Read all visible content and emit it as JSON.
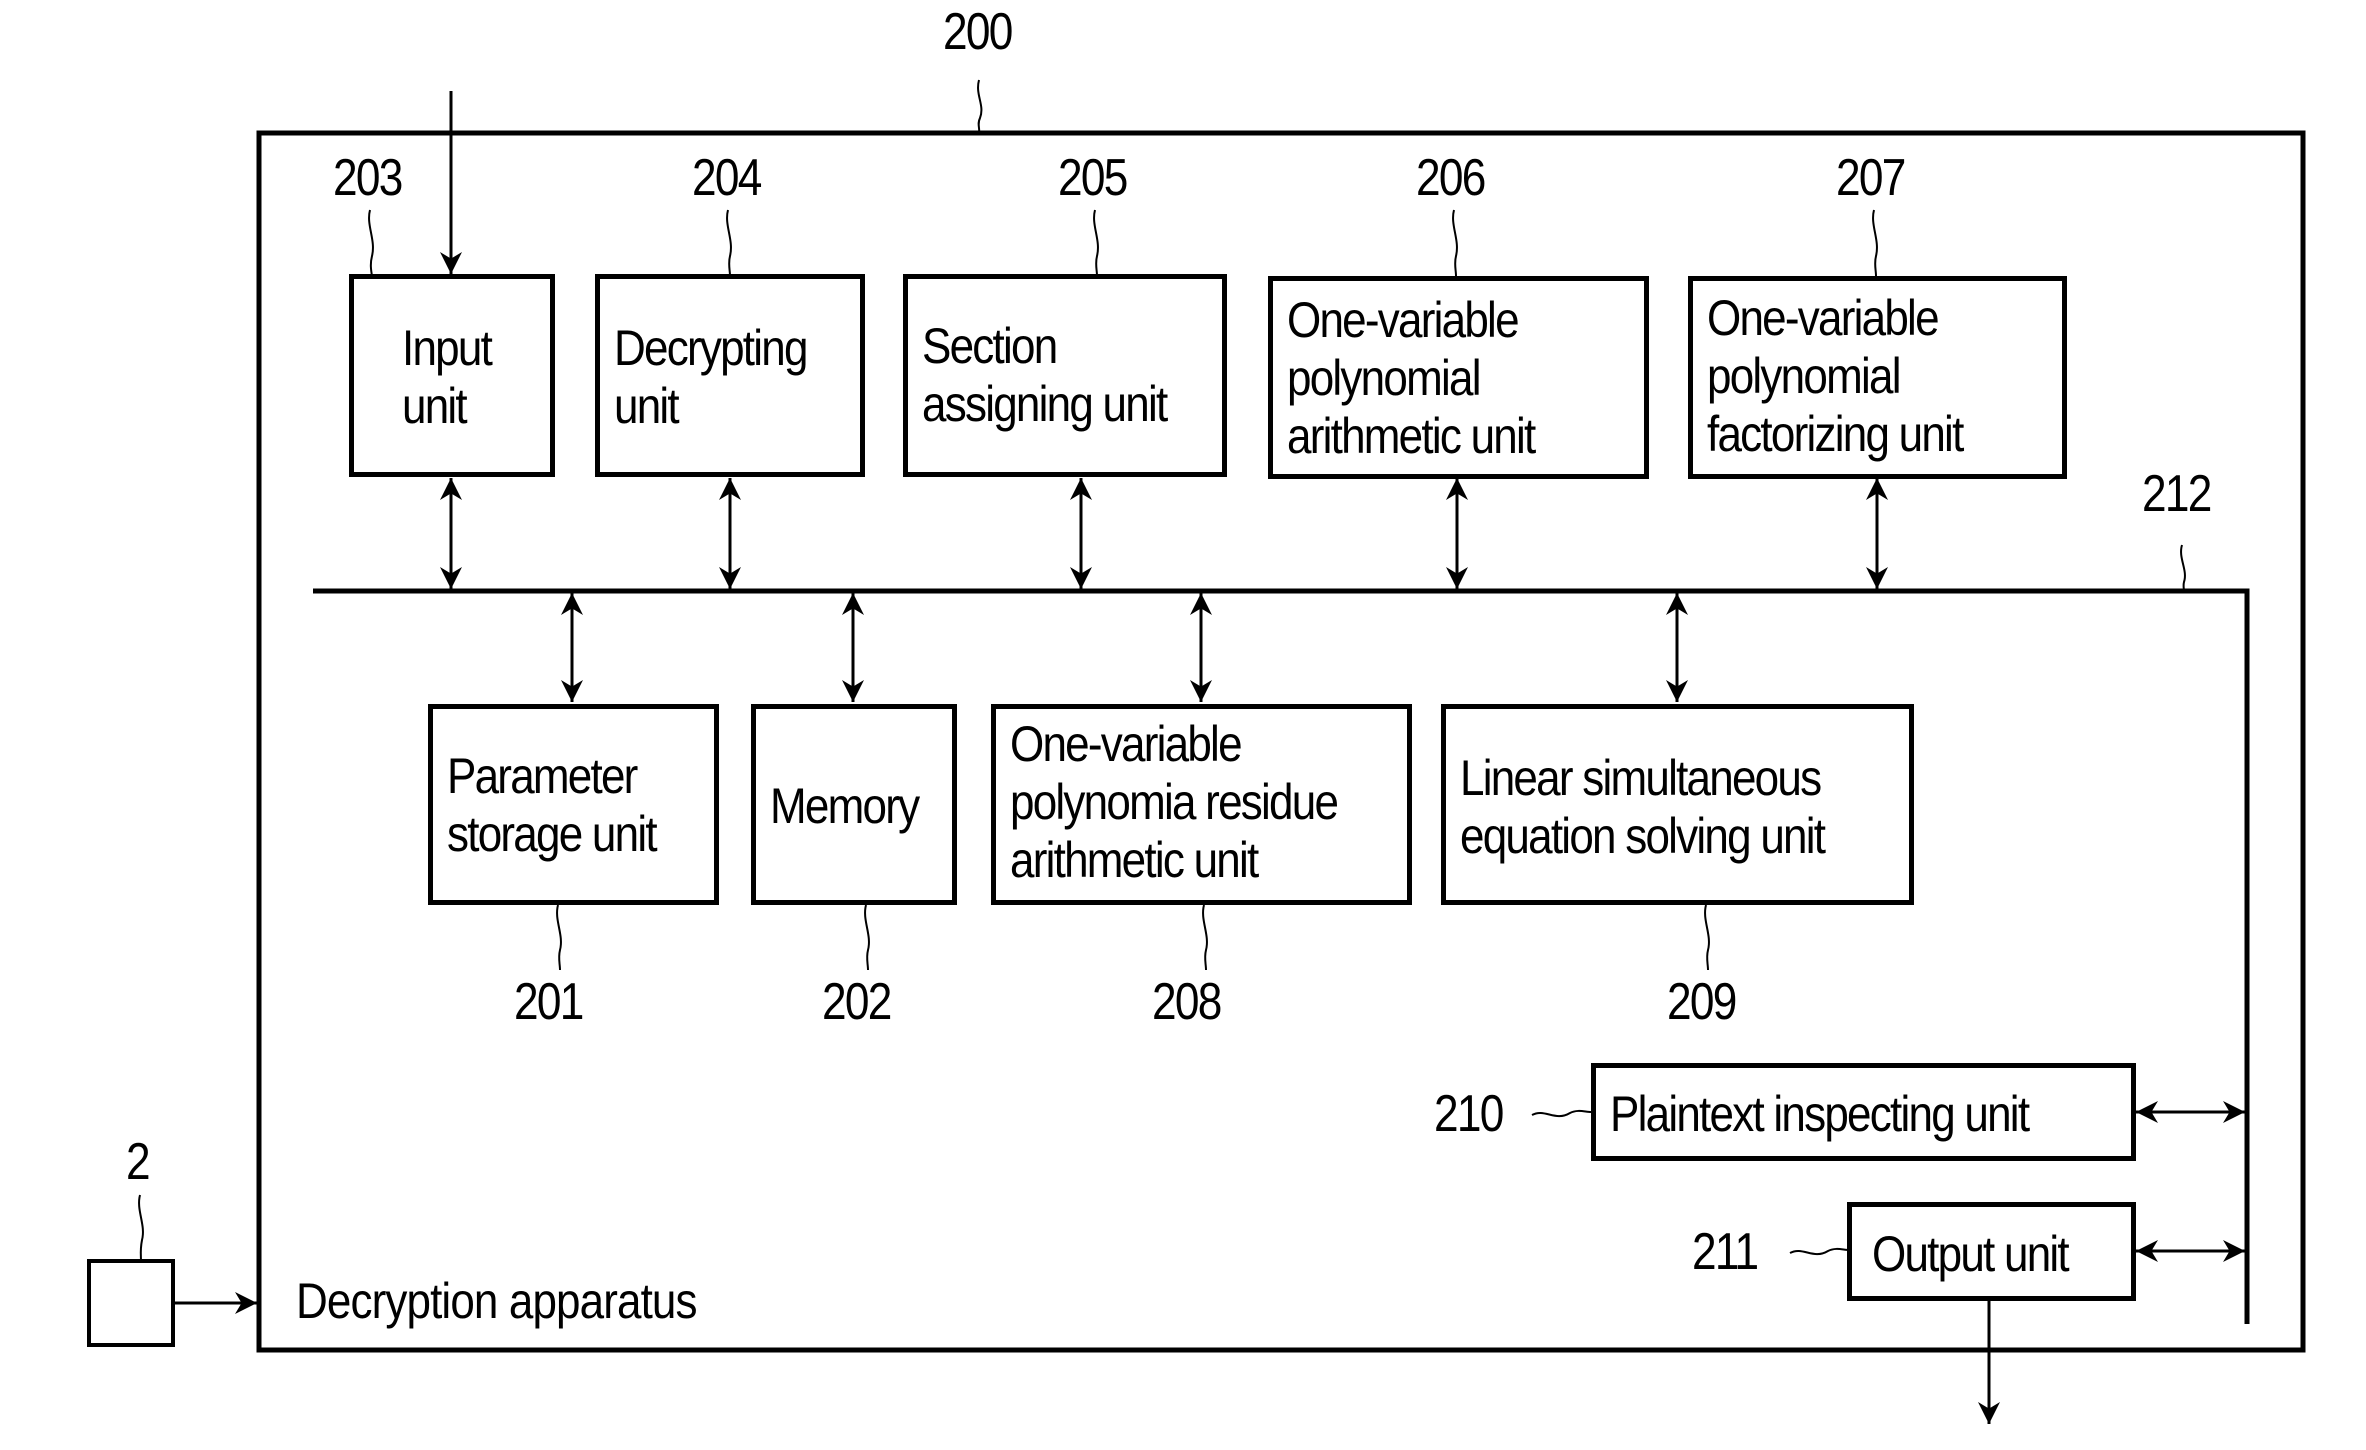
{
  "figure": {
    "apparatus_label": "Decryption apparatus",
    "apparatus_ref": "200",
    "bus_ref": "212",
    "external_ref": "2",
    "colors": {
      "line": "#000000",
      "background": "#ffffff"
    }
  },
  "units": [
    {
      "ref": "203",
      "lines": [
        "Input",
        "unit"
      ]
    },
    {
      "ref": "204",
      "lines": [
        "Decrypting",
        "unit"
      ]
    },
    {
      "ref": "205",
      "lines": [
        "Section",
        "assigning unit"
      ]
    },
    {
      "ref": "206",
      "lines": [
        "One-variable",
        "polynomial",
        "arithmetic unit"
      ]
    },
    {
      "ref": "207",
      "lines": [
        "One-variable",
        "polynomial",
        "factorizing unit"
      ]
    },
    {
      "ref": "201",
      "lines": [
        "Parameter",
        "storage unit"
      ]
    },
    {
      "ref": "202",
      "lines": [
        "Memory"
      ]
    },
    {
      "ref": "208",
      "lines": [
        "One-variable",
        "polynomia residue",
        "arithmetic unit"
      ]
    },
    {
      "ref": "209",
      "lines": [
        "Linear simultaneous",
        "equation solving unit"
      ]
    },
    {
      "ref": "210",
      "lines": [
        "Plaintext inspecting unit"
      ]
    },
    {
      "ref": "211",
      "lines": [
        "Output unit"
      ]
    }
  ]
}
